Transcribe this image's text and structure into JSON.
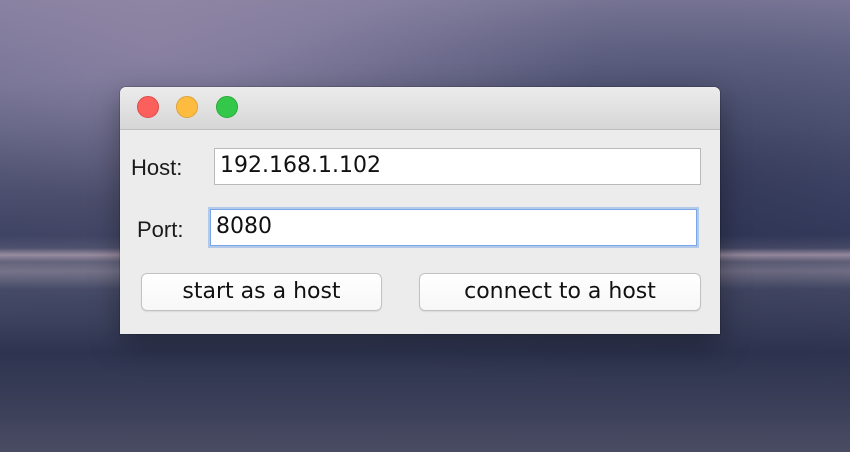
{
  "form": {
    "host_label": "Host:",
    "host_value": "192.168.1.102",
    "port_label": "Port:",
    "port_value": "8080"
  },
  "buttons": {
    "start_host": "start as a host",
    "connect_host": "connect to a host"
  },
  "colors": {
    "close": "#fc605c",
    "minimize": "#fdbc40",
    "zoom": "#34c84a",
    "focus_ring": "#7aa7e6"
  }
}
